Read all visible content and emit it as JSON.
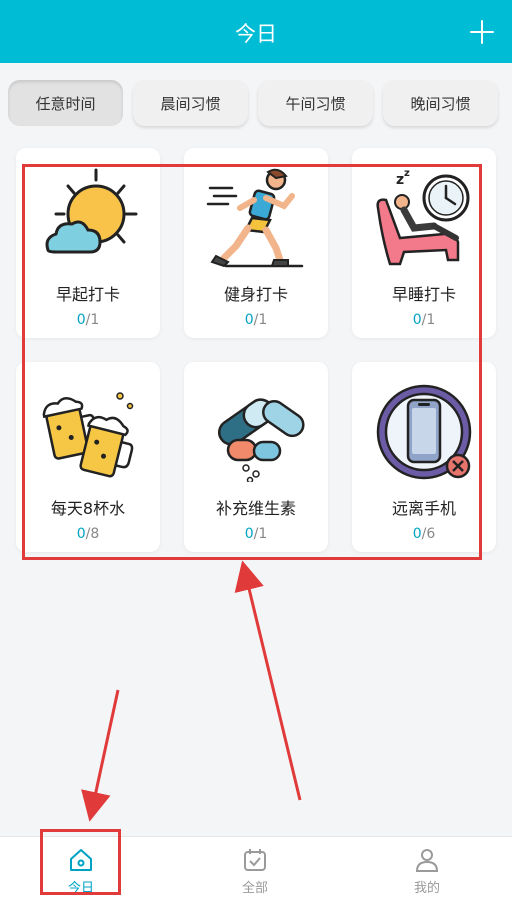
{
  "header": {
    "title": "今日",
    "add_icon": "plus-icon"
  },
  "tabs": [
    {
      "label": "任意时间",
      "active": true
    },
    {
      "label": "晨间习惯"
    },
    {
      "label": "午间习惯"
    },
    {
      "label": "晚间习惯"
    }
  ],
  "habits": [
    {
      "name": "早起打卡",
      "done": "0",
      "total": "/1",
      "icon": "sun-cloud-icon"
    },
    {
      "name": "健身打卡",
      "done": "0",
      "total": "/1",
      "icon": "runner-icon"
    },
    {
      "name": "早睡打卡",
      "done": "0",
      "total": "/1",
      "icon": "sleep-clock-icon"
    },
    {
      "name": "每天8杯水",
      "done": "0",
      "total": "/8",
      "icon": "beer-mugs-icon"
    },
    {
      "name": "补充维生素",
      "done": "0",
      "total": "/1",
      "icon": "pills-icon"
    },
    {
      "name": "远离手机",
      "done": "0",
      "total": "/6",
      "icon": "no-phone-icon"
    }
  ],
  "bottom_nav": [
    {
      "label": "今日",
      "icon": "home-icon",
      "active": true
    },
    {
      "label": "全部",
      "icon": "calendar-check-icon"
    },
    {
      "label": "我的",
      "icon": "user-icon"
    }
  ],
  "colors": {
    "header": "#00bcd4",
    "accent": "#00a2c3",
    "annotation": "#e03a3a"
  }
}
